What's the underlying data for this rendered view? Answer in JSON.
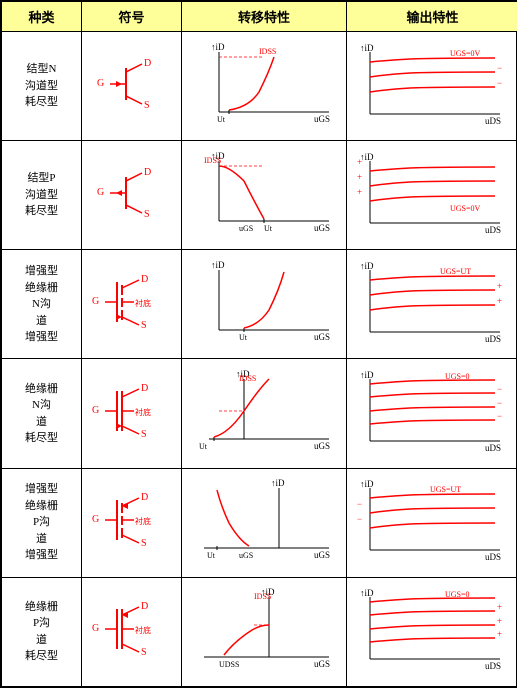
{
  "header": {
    "col1": "种类",
    "col2": "符号",
    "col3": "转移特性",
    "col4": "输出特性"
  },
  "sections": [
    {
      "group": "结型N\n沟道型",
      "rows": [
        {
          "subtype": "耗尽型"
        }
      ]
    },
    {
      "group": "结型P\n沟道型",
      "rows": [
        {
          "subtype": "耗尽型"
        }
      ]
    },
    {
      "group": "增强型\n绝缘栅\nN沟\n道",
      "rows": [
        {
          "subtype": "增强型"
        },
        {
          "subtype": "耗尽型"
        }
      ]
    },
    {
      "group": "增强型\n绝缘栅\nP沟\n道",
      "rows": [
        {
          "subtype": "增强型"
        },
        {
          "subtype": "耗尽型"
        }
      ]
    }
  ]
}
